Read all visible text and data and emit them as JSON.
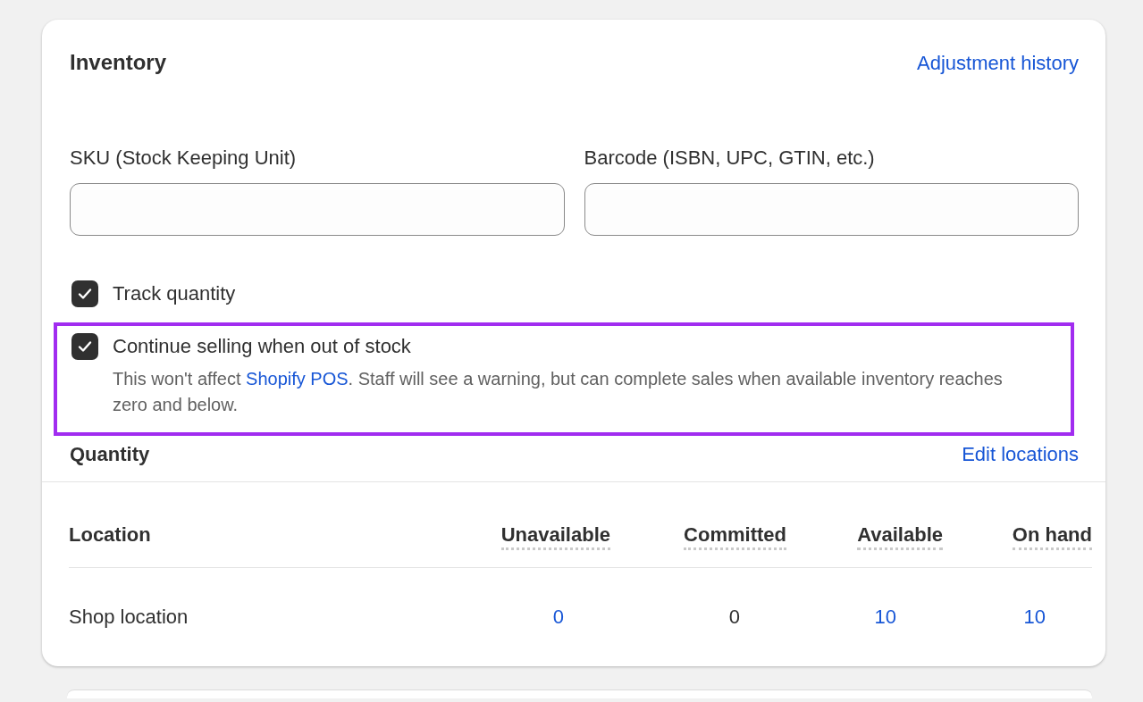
{
  "card": {
    "title": "Inventory",
    "header_link": "Adjustment history"
  },
  "fields": [
    {
      "label": "SKU (Stock Keeping Unit)"
    },
    {
      "label": "Barcode (ISBN, UPC, GTIN, etc.)"
    }
  ],
  "options": [
    {
      "label": "Track quantity",
      "checked": true,
      "highlighted": false
    },
    {
      "label": "Continue selling when out of stock",
      "checked": true,
      "highlighted": true,
      "help_before": "This won't affect ",
      "help_link": "Shopify POS",
      "help_after": ". Staff will see a warning, but can complete sales when available inventory reaches zero and below."
    }
  ],
  "quantity": {
    "title": "Quantity",
    "link": "Edit locations",
    "columns": [
      {
        "label": "Location",
        "underlined": false
      },
      {
        "label": "Unavailable",
        "underlined": true
      },
      {
        "label": "Committed",
        "underlined": true
      },
      {
        "label": "Available",
        "underlined": true
      },
      {
        "label": "On hand",
        "underlined": true
      }
    ],
    "rows": [
      {
        "cells": [
          {
            "text": "Shop location",
            "link": false
          },
          {
            "text": "0",
            "link": true
          },
          {
            "text": "0",
            "link": false
          },
          {
            "text": "10",
            "link": true
          },
          {
            "text": "10",
            "link": true
          }
        ]
      }
    ]
  }
}
